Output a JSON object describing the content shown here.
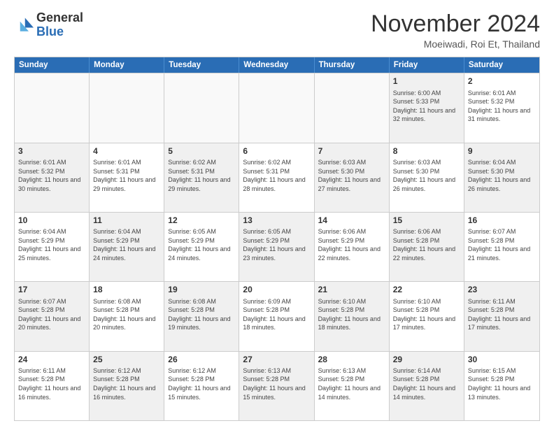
{
  "logo": {
    "general": "General",
    "blue": "Blue"
  },
  "header": {
    "month": "November 2024",
    "location": "Moeiwadi, Roi Et, Thailand"
  },
  "weekdays": [
    "Sunday",
    "Monday",
    "Tuesday",
    "Wednesday",
    "Thursday",
    "Friday",
    "Saturday"
  ],
  "rows": [
    [
      {
        "day": "",
        "text": "",
        "empty": true
      },
      {
        "day": "",
        "text": "",
        "empty": true
      },
      {
        "day": "",
        "text": "",
        "empty": true
      },
      {
        "day": "",
        "text": "",
        "empty": true
      },
      {
        "day": "",
        "text": "",
        "empty": true
      },
      {
        "day": "1",
        "text": "Sunrise: 6:00 AM\nSunset: 5:33 PM\nDaylight: 11 hours and 32 minutes.",
        "shaded": true
      },
      {
        "day": "2",
        "text": "Sunrise: 6:01 AM\nSunset: 5:32 PM\nDaylight: 11 hours and 31 minutes.",
        "shaded": false
      }
    ],
    [
      {
        "day": "3",
        "text": "Sunrise: 6:01 AM\nSunset: 5:32 PM\nDaylight: 11 hours and 30 minutes.",
        "shaded": true
      },
      {
        "day": "4",
        "text": "Sunrise: 6:01 AM\nSunset: 5:31 PM\nDaylight: 11 hours and 29 minutes.",
        "shaded": false
      },
      {
        "day": "5",
        "text": "Sunrise: 6:02 AM\nSunset: 5:31 PM\nDaylight: 11 hours and 29 minutes.",
        "shaded": true
      },
      {
        "day": "6",
        "text": "Sunrise: 6:02 AM\nSunset: 5:31 PM\nDaylight: 11 hours and 28 minutes.",
        "shaded": false
      },
      {
        "day": "7",
        "text": "Sunrise: 6:03 AM\nSunset: 5:30 PM\nDaylight: 11 hours and 27 minutes.",
        "shaded": true
      },
      {
        "day": "8",
        "text": "Sunrise: 6:03 AM\nSunset: 5:30 PM\nDaylight: 11 hours and 26 minutes.",
        "shaded": false
      },
      {
        "day": "9",
        "text": "Sunrise: 6:04 AM\nSunset: 5:30 PM\nDaylight: 11 hours and 26 minutes.",
        "shaded": true
      }
    ],
    [
      {
        "day": "10",
        "text": "Sunrise: 6:04 AM\nSunset: 5:29 PM\nDaylight: 11 hours and 25 minutes.",
        "shaded": false
      },
      {
        "day": "11",
        "text": "Sunrise: 6:04 AM\nSunset: 5:29 PM\nDaylight: 11 hours and 24 minutes.",
        "shaded": true
      },
      {
        "day": "12",
        "text": "Sunrise: 6:05 AM\nSunset: 5:29 PM\nDaylight: 11 hours and 24 minutes.",
        "shaded": false
      },
      {
        "day": "13",
        "text": "Sunrise: 6:05 AM\nSunset: 5:29 PM\nDaylight: 11 hours and 23 minutes.",
        "shaded": true
      },
      {
        "day": "14",
        "text": "Sunrise: 6:06 AM\nSunset: 5:29 PM\nDaylight: 11 hours and 22 minutes.",
        "shaded": false
      },
      {
        "day": "15",
        "text": "Sunrise: 6:06 AM\nSunset: 5:28 PM\nDaylight: 11 hours and 22 minutes.",
        "shaded": true
      },
      {
        "day": "16",
        "text": "Sunrise: 6:07 AM\nSunset: 5:28 PM\nDaylight: 11 hours and 21 minutes.",
        "shaded": false
      }
    ],
    [
      {
        "day": "17",
        "text": "Sunrise: 6:07 AM\nSunset: 5:28 PM\nDaylight: 11 hours and 20 minutes.",
        "shaded": true
      },
      {
        "day": "18",
        "text": "Sunrise: 6:08 AM\nSunset: 5:28 PM\nDaylight: 11 hours and 20 minutes.",
        "shaded": false
      },
      {
        "day": "19",
        "text": "Sunrise: 6:08 AM\nSunset: 5:28 PM\nDaylight: 11 hours and 19 minutes.",
        "shaded": true
      },
      {
        "day": "20",
        "text": "Sunrise: 6:09 AM\nSunset: 5:28 PM\nDaylight: 11 hours and 18 minutes.",
        "shaded": false
      },
      {
        "day": "21",
        "text": "Sunrise: 6:10 AM\nSunset: 5:28 PM\nDaylight: 11 hours and 18 minutes.",
        "shaded": true
      },
      {
        "day": "22",
        "text": "Sunrise: 6:10 AM\nSunset: 5:28 PM\nDaylight: 11 hours and 17 minutes.",
        "shaded": false
      },
      {
        "day": "23",
        "text": "Sunrise: 6:11 AM\nSunset: 5:28 PM\nDaylight: 11 hours and 17 minutes.",
        "shaded": true
      }
    ],
    [
      {
        "day": "24",
        "text": "Sunrise: 6:11 AM\nSunset: 5:28 PM\nDaylight: 11 hours and 16 minutes.",
        "shaded": false
      },
      {
        "day": "25",
        "text": "Sunrise: 6:12 AM\nSunset: 5:28 PM\nDaylight: 11 hours and 16 minutes.",
        "shaded": true
      },
      {
        "day": "26",
        "text": "Sunrise: 6:12 AM\nSunset: 5:28 PM\nDaylight: 11 hours and 15 minutes.",
        "shaded": false
      },
      {
        "day": "27",
        "text": "Sunrise: 6:13 AM\nSunset: 5:28 PM\nDaylight: 11 hours and 15 minutes.",
        "shaded": true
      },
      {
        "day": "28",
        "text": "Sunrise: 6:13 AM\nSunset: 5:28 PM\nDaylight: 11 hours and 14 minutes.",
        "shaded": false
      },
      {
        "day": "29",
        "text": "Sunrise: 6:14 AM\nSunset: 5:28 PM\nDaylight: 11 hours and 14 minutes.",
        "shaded": true
      },
      {
        "day": "30",
        "text": "Sunrise: 6:15 AM\nSunset: 5:28 PM\nDaylight: 11 hours and 13 minutes.",
        "shaded": false
      }
    ]
  ]
}
